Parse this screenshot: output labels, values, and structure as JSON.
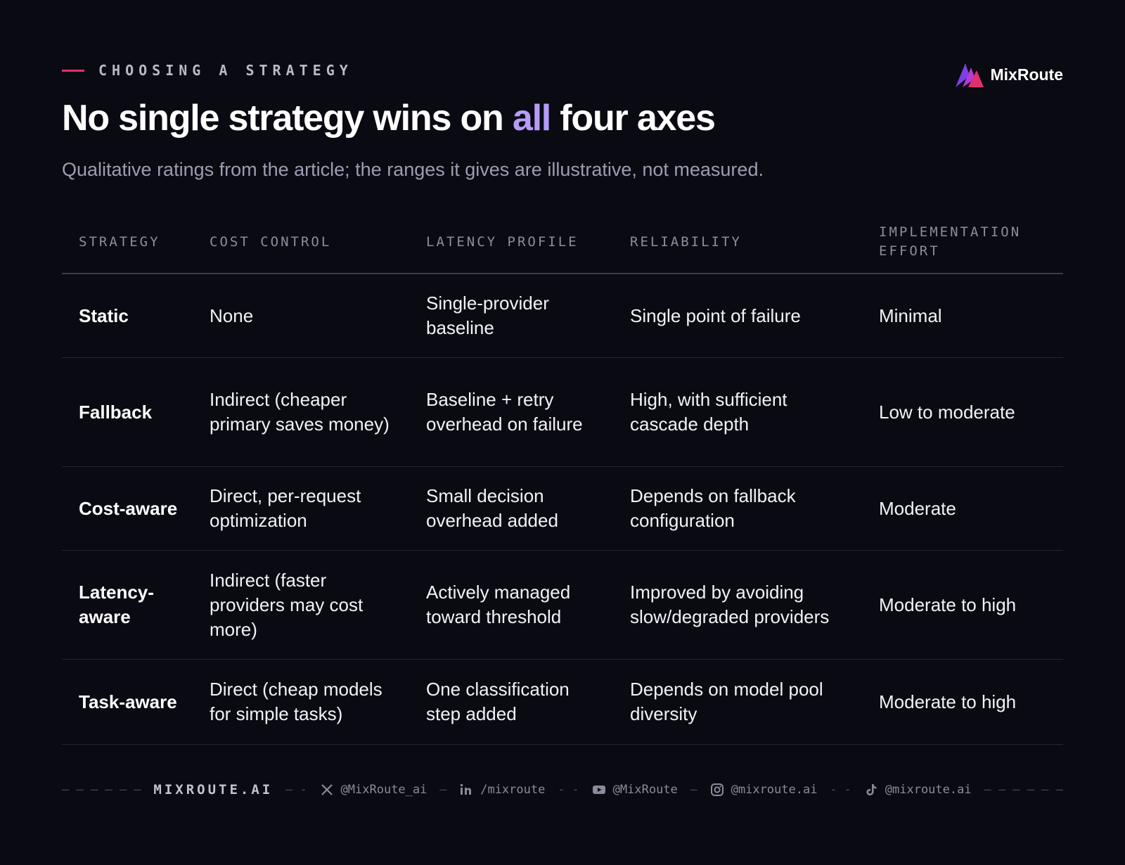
{
  "header": {
    "kicker": "CHOOSING A STRATEGY",
    "title_before": "No single strategy wins on ",
    "title_highlight": "all",
    "title_after": " four axes",
    "subtitle": "Qualitative ratings from the article; the ranges it gives are illustrative, not measured."
  },
  "brand": {
    "name": "MixRoute",
    "icon": "mixroute-logo-icon"
  },
  "table": {
    "columns": [
      "STRATEGY",
      "COST CONTROL",
      "LATENCY PROFILE",
      "RELIABILITY",
      "IMPLEMENTATION EFFORT"
    ],
    "rows": [
      [
        "Static",
        "None",
        "Single-provider baseline",
        "Single point of failure",
        "Minimal"
      ],
      [
        "Fallback",
        "Indirect (cheaper primary saves money)",
        "Baseline + retry overhead on failure",
        "High, with sufficient cascade depth",
        "Low to moderate"
      ],
      [
        "Cost-aware",
        "Direct, per-request optimization",
        "Small decision overhead added",
        "Depends on fallback configuration",
        "Moderate"
      ],
      [
        "Latency-aware",
        "Indirect (faster providers may cost more)",
        "Actively managed toward threshold",
        "Improved by avoiding slow/degraded providers",
        "Moderate to high"
      ],
      [
        "Task-aware",
        "Direct (cheap models for simple tasks)",
        "One classification step added",
        "Depends on model pool diversity",
        "Moderate to high"
      ]
    ]
  },
  "footer": {
    "site": "MIXROUTE.AI",
    "socials": [
      {
        "icon": "x-icon",
        "handle": "@MixRoute_ai"
      },
      {
        "icon": "linkedin-icon",
        "handle": "/mixroute"
      },
      {
        "icon": "youtube-icon",
        "handle": "@MixRoute"
      },
      {
        "icon": "instagram-icon",
        "handle": "@mixroute.ai"
      },
      {
        "icon": "tiktok-icon",
        "handle": "@mixroute.ai"
      }
    ]
  },
  "colors": {
    "background": "#0a0a12",
    "accent_purple": "#b69cf6",
    "accent_pink": "#e0316f"
  }
}
